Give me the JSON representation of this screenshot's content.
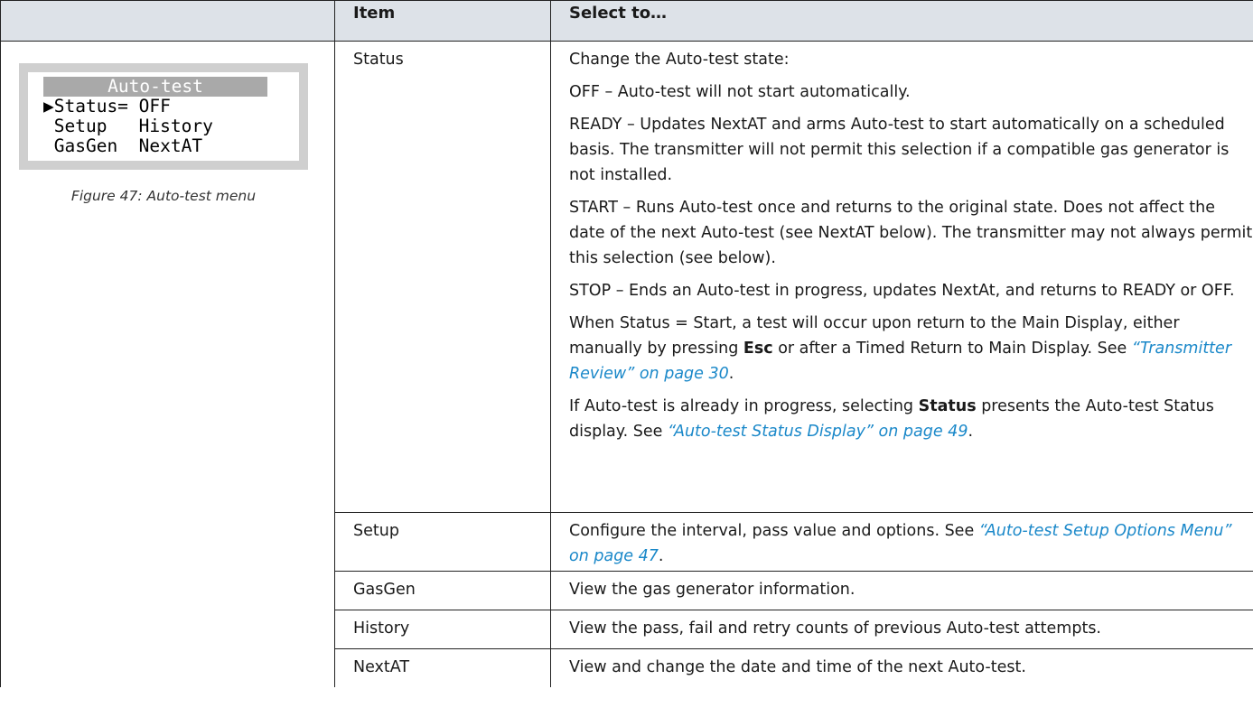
{
  "header": {
    "col_figure": "",
    "col_item": "Item",
    "col_select": "Select to…"
  },
  "figure": {
    "screen_title": "Auto-test",
    "line1": "▶Status= OFF",
    "line2": " Setup   History",
    "line3": " GasGen  NextAT",
    "caption": "Figure 47:  Auto-test menu"
  },
  "rows": {
    "status": {
      "item": "Status",
      "intro": "Change the Auto-test state:",
      "off": "OFF – Auto-test will not start automatically.",
      "ready": "READY – Updates NextAT and arms Auto-test to start automatically on a scheduled basis. The transmitter will not permit this selection if a compatible gas generator is not installed.",
      "start": "START – Runs Auto-test once and returns to the original state. Does not affect the date of the next Auto-test (see NextAT below). The transmitter may not always permit this selection (see below).",
      "stop": "STOP – Ends an Auto-test in progress, updates NextAt, and returns to READY or OFF.",
      "when_a": "When Status = Start, a test will occur upon return to the Main Display, either manually by pressing ",
      "when_key": "Esc",
      "when_b": " or after a Timed Return to Main Display. See ",
      "when_link": "“Transmitter Review” on page 30",
      "when_end": ".",
      "if_a": "If Auto-test is already in progress, selecting ",
      "if_key": "Status",
      "if_b": " presents the Auto-test Status display. See ",
      "if_link": "“Auto-test Status Display” on page 49",
      "if_end": "."
    },
    "setup": {
      "item": "Setup",
      "desc_a": "Configure the interval, pass value and options. See ",
      "desc_link": "“Auto-test Setup Options Menu” on page 47",
      "desc_end": "."
    },
    "gasgen": {
      "item": "GasGen",
      "desc": "View the gas generator information."
    },
    "history": {
      "item": "History",
      "desc": "View the pass, fail and retry counts of previous Auto-test attempts."
    },
    "nextat": {
      "item": "NextAT",
      "desc": "View and change the date and time of the next Auto-test."
    }
  }
}
